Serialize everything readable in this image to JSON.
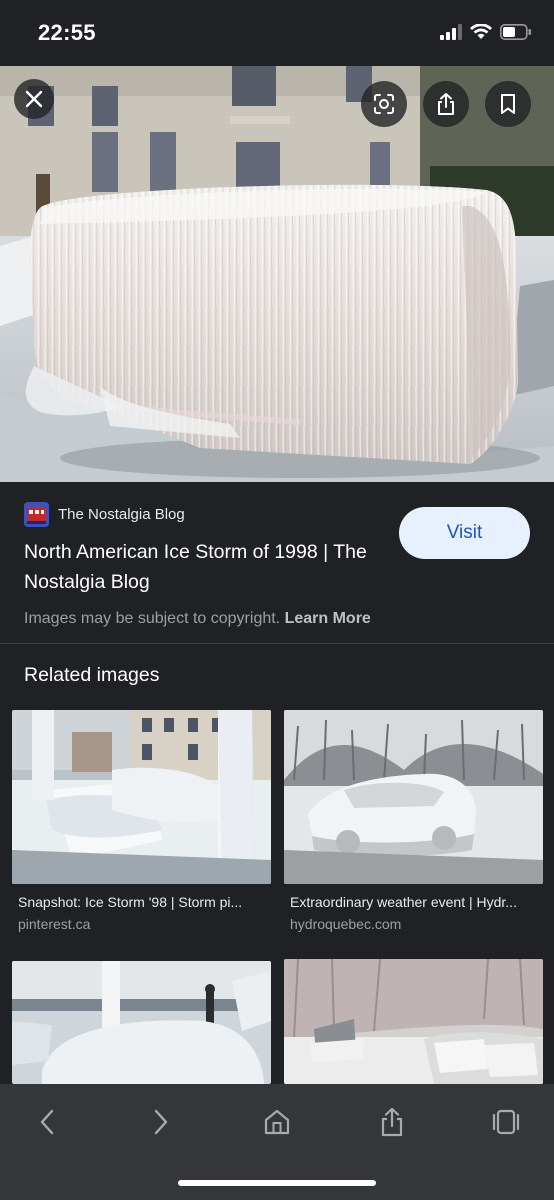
{
  "status_bar": {
    "time": "22:55",
    "icons": [
      "signal-bars-icon",
      "wifi-icon",
      "battery-icon"
    ]
  },
  "hero": {
    "description_icons": [
      "close-icon",
      "lens-icon",
      "share-icon",
      "bookmark-icon"
    ]
  },
  "result": {
    "source_name": "The Nostalgia Blog",
    "title": "North American Ice Storm of 1998 | The Nostalgia Blog",
    "visit_label": "Visit",
    "copyright_text": "Images may be subject to copyright.",
    "learn_more": "Learn More"
  },
  "related": {
    "heading": "Related images",
    "items": [
      {
        "caption": "Snapshot: Ice Storm '98 | Storm pi...",
        "domain": "pinterest.ca"
      },
      {
        "caption": "Extraordinary weather event | Hydr...",
        "domain": "hydroquebec.com"
      },
      {
        "caption": "",
        "domain": ""
      },
      {
        "caption": "",
        "domain": ""
      }
    ]
  },
  "toolbar": {
    "icons": [
      "back-icon",
      "forward-icon",
      "home-icon",
      "share-icon",
      "tabs-icon"
    ]
  },
  "colors": {
    "background": "#202124",
    "toolbar": "#35363a",
    "visit_button_bg": "#e8f0fe",
    "visit_button_text": "#1a56c4",
    "secondary_text": "#9aa0a6"
  }
}
